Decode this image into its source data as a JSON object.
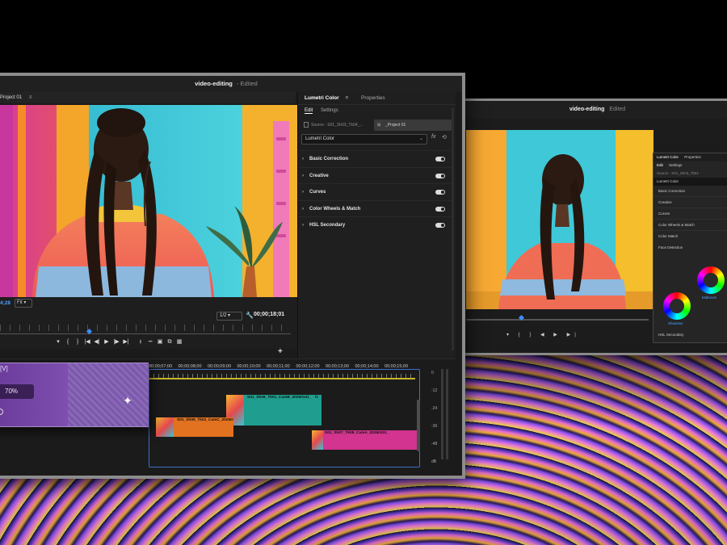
{
  "main_window": {
    "title": "video-editing",
    "subtitle": "- Edited",
    "program_tab": "Project 01",
    "program_menu": "≡",
    "viewer": {
      "timecode_current": "4;28",
      "fit_option": "Fit",
      "zoom": "1/2",
      "timecode_duration": "00;00;18;01"
    },
    "transport_icons": [
      "marker-icon",
      "in-point-icon",
      "out-point-icon",
      "go-to-in-icon",
      "step-back-icon",
      "play-icon",
      "step-forward-icon",
      "go-to-out-icon",
      "insert-icon",
      "overwrite-icon",
      "camera-icon",
      "export-frame-icon",
      "compare-icon"
    ],
    "transport_glyphs": [
      "▾",
      "{",
      "}",
      "|◀",
      "◀|",
      "▶",
      "|▶",
      "▶|",
      "⭳",
      "⭲",
      "▣",
      "⧉",
      "▦"
    ],
    "add_button": "+"
  },
  "lumetri": {
    "tab_active": "Lumetri Color",
    "tab_menu": "≡",
    "tab_other": "Properties",
    "sub_tab_active": "Edit",
    "sub_tab_other": "Settings",
    "source_label": "Source - S01_Sh03_Tk04_...",
    "sequence_label": "_Project 01",
    "effect_select": "Lumetri Color",
    "sections": [
      {
        "label": "Basic Correction",
        "enabled": true
      },
      {
        "label": "Creative",
        "enabled": true
      },
      {
        "label": "Curves",
        "enabled": true
      },
      {
        "label": "Color Wheels & Match",
        "enabled": true
      },
      {
        "label": "HSL Secondary",
        "enabled": true
      }
    ]
  },
  "timeline": {
    "ruler_ticks": [
      "00;00;07;00",
      "00;00;08;00",
      "00;00;09;00",
      "00;00;10;00",
      "00;00;11;00",
      "00;00;12;00",
      "00;00;13;00",
      "00;00;14;00",
      "00;00;15;00"
    ],
    "clips": [
      {
        "name": "S01_Sh06_Tk01_CamB_20250101_",
        "color": "#1f9e8f"
      },
      {
        "name": "S01_Sh05_Tk02_CamC_20250101_",
        "color": "#e2721f"
      },
      {
        "name": "S01_Sh07_Tk08_CamA_20250101_",
        "color": "#d2348f"
      }
    ],
    "fx_label": "fx",
    "generative_panel": {
      "track_label": "[V]",
      "progress_percent": 70,
      "progress_text": "70%"
    },
    "meter_labels": [
      "0",
      "-12",
      "-24",
      "-36",
      "-48",
      "dB"
    ]
  },
  "second_window": {
    "title": "video-editing",
    "subtitle": "Edited",
    "lumetri_tab": "Lumetri Color",
    "lumetri_other": "Properties",
    "edit_tab": "Edit",
    "settings_tab": "Settings",
    "source_label": "Source - S01_Sh03_Tk04",
    "effect_label": "Lumetri Color",
    "rows": [
      "Basic Correction",
      "Creative",
      "Curves",
      "Color Wheels & Match",
      "Color Match",
      "Face Detection"
    ],
    "wheel_midtones": "Midtones",
    "wheel_shadows": "Shadows",
    "hsl_label": "HSL Secondary"
  },
  "colors": {
    "accent_blue": "#3c8dff",
    "timecode_blue": "#4aa0ff",
    "generative_purple": "#5a2f84"
  }
}
